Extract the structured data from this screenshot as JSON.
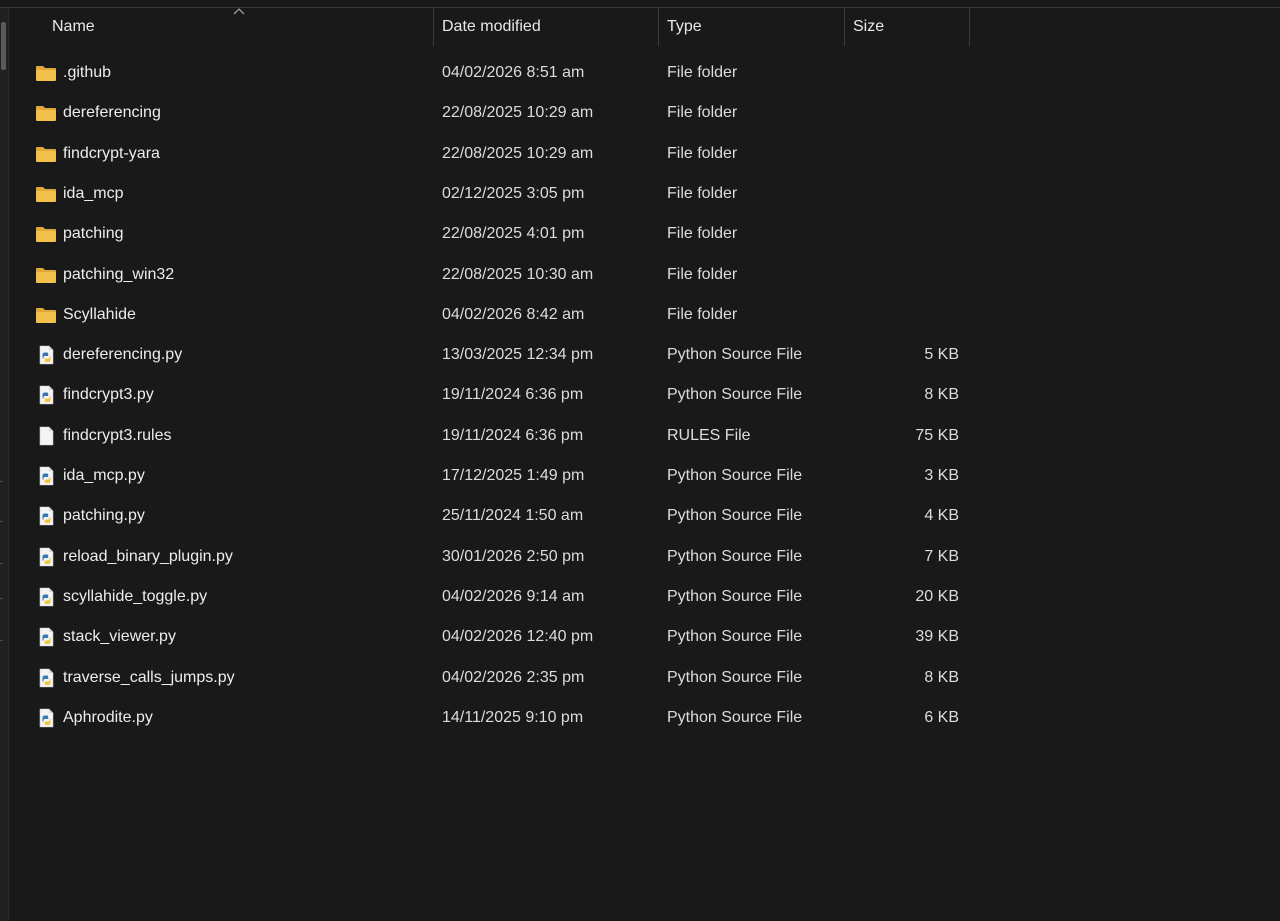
{
  "columns": {
    "name": "Name",
    "date": "Date modified",
    "type": "Type",
    "size": "Size"
  },
  "icons": {
    "folder": "folder-icon",
    "python": "python-file-icon",
    "generic": "file-icon",
    "sort": "sort-ascending-icon"
  },
  "colors": {
    "background": "#191919",
    "folder": "#f3c04c",
    "python_blue": "#3a76b0",
    "python_yellow": "#f2c53d"
  },
  "files": [
    {
      "name": ".github",
      "date": "04/02/2026 8:51 am",
      "type": "File folder",
      "size": "",
      "icon": "folder"
    },
    {
      "name": "dereferencing",
      "date": "22/08/2025 10:29 am",
      "type": "File folder",
      "size": "",
      "icon": "folder"
    },
    {
      "name": "findcrypt-yara",
      "date": "22/08/2025 10:29 am",
      "type": "File folder",
      "size": "",
      "icon": "folder"
    },
    {
      "name": "ida_mcp",
      "date": "02/12/2025 3:05 pm",
      "type": "File folder",
      "size": "",
      "icon": "folder"
    },
    {
      "name": "patching",
      "date": "22/08/2025 4:01 pm",
      "type": "File folder",
      "size": "",
      "icon": "folder"
    },
    {
      "name": "patching_win32",
      "date": "22/08/2025 10:30 am",
      "type": "File folder",
      "size": "",
      "icon": "folder"
    },
    {
      "name": "Scyllahide",
      "date": "04/02/2026 8:42 am",
      "type": "File folder",
      "size": "",
      "icon": "folder"
    },
    {
      "name": "dereferencing.py",
      "date": "13/03/2025 12:34 pm",
      "type": "Python Source File",
      "size": "5 KB",
      "icon": "python"
    },
    {
      "name": "findcrypt3.py",
      "date": "19/11/2024 6:36 pm",
      "type": "Python Source File",
      "size": "8 KB",
      "icon": "python"
    },
    {
      "name": "findcrypt3.rules",
      "date": "19/11/2024 6:36 pm",
      "type": "RULES File",
      "size": "75 KB",
      "icon": "generic"
    },
    {
      "name": "ida_mcp.py",
      "date": "17/12/2025 1:49 pm",
      "type": "Python Source File",
      "size": "3 KB",
      "icon": "python"
    },
    {
      "name": "patching.py",
      "date": "25/11/2024 1:50 am",
      "type": "Python Source File",
      "size": "4 KB",
      "icon": "python"
    },
    {
      "name": "reload_binary_plugin.py",
      "date": "30/01/2026 2:50 pm",
      "type": "Python Source File",
      "size": "7 KB",
      "icon": "python"
    },
    {
      "name": "scyllahide_toggle.py",
      "date": "04/02/2026 9:14 am",
      "type": "Python Source File",
      "size": "20 KB",
      "icon": "python"
    },
    {
      "name": "stack_viewer.py",
      "date": "04/02/2026 12:40 pm",
      "type": "Python Source File",
      "size": "39 KB",
      "icon": "python"
    },
    {
      "name": "traverse_calls_jumps.py",
      "date": "04/02/2026 2:35 pm",
      "type": "Python Source File",
      "size": "8 KB",
      "icon": "python"
    },
    {
      "name": "Aphrodite.py",
      "date": "14/11/2025 9:10 pm",
      "type": "Python Source File",
      "size": "6 KB",
      "icon": "python"
    }
  ]
}
